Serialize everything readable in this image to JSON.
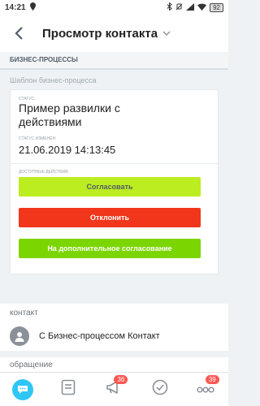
{
  "status_bar": {
    "time": "14:21",
    "battery": "92"
  },
  "header": {
    "title": "Просмотр контакта"
  },
  "section": {
    "title": "БИЗНЕС-ПРОЦЕССЫ"
  },
  "template": {
    "label": "Шаблон бизнес-процесса"
  },
  "card": {
    "status_caption": "СТАТУС",
    "status_value": "Пример развилки с действиями",
    "changed_caption": "СТАТУС ИЗМЕНЁН",
    "changed_value": "21.06.2019 14:13:45",
    "actions_caption": "ДОСТУПНЫЕ ДЕЙСТВИЯ",
    "approve_label": "Согласовать",
    "reject_label": "Отклонить",
    "extra_label": "На дополнительное согласование"
  },
  "contact": {
    "heading": "контакт",
    "name": "С Бизнес-процессом Контакт"
  },
  "appeal": {
    "heading": "обращение"
  },
  "tabbar": {
    "notifications_badge": "36",
    "more_badge": "39"
  },
  "colors": {
    "approve": "#bbed21",
    "reject": "#f1361b",
    "extra": "#7bd500",
    "chat_accent": "#2fc6f6",
    "badge": "#ff5752"
  }
}
